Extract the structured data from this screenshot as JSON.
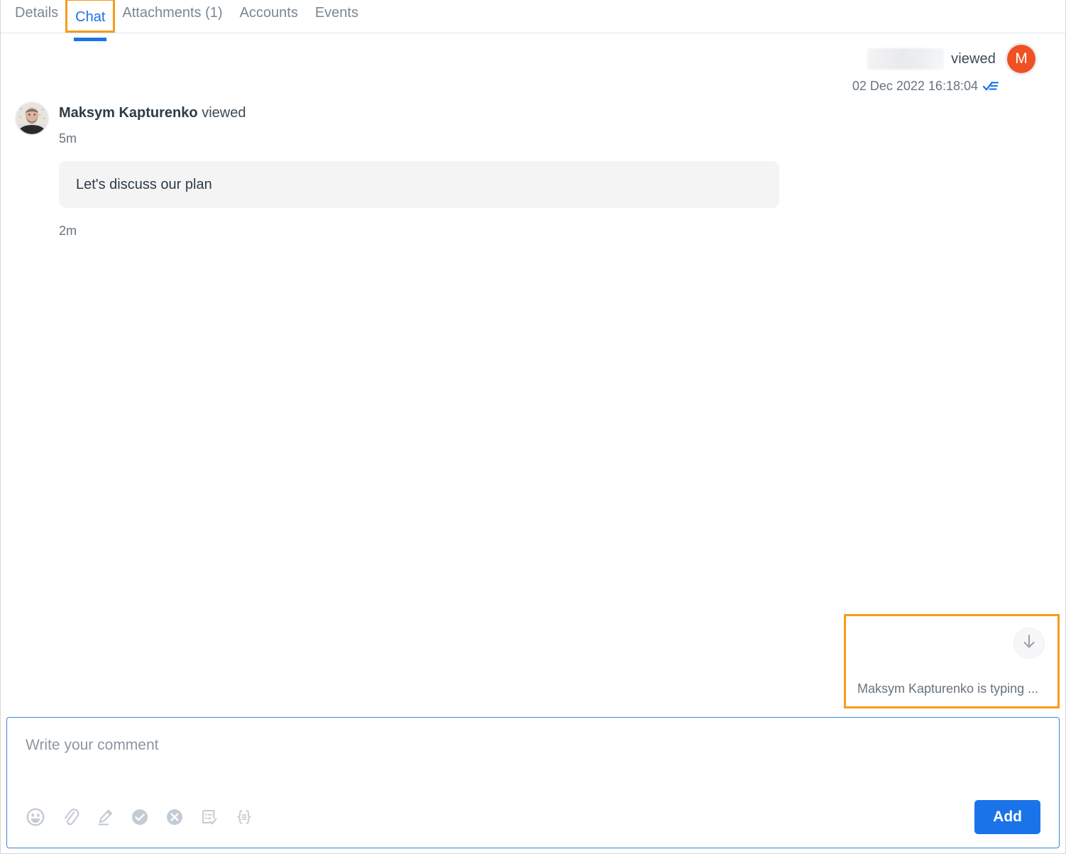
{
  "tabs": [
    {
      "label": "Details",
      "active": false,
      "highlighted": false
    },
    {
      "label": "Chat",
      "active": true,
      "highlighted": true
    },
    {
      "label": "Attachments (1)",
      "active": false,
      "highlighted": false
    },
    {
      "label": "Accounts",
      "active": false,
      "highlighted": false
    },
    {
      "label": "Events",
      "active": false,
      "highlighted": false
    }
  ],
  "colors": {
    "accent_blue": "#1a73e8",
    "highlight_orange": "#f59b1c",
    "avatar_orange": "#f05123",
    "text_muted": "#68737e",
    "bubble_bg": "#f4f4f5"
  },
  "chat": {
    "right_event": {
      "name_redacted": "",
      "action": "viewed",
      "timestamp": "02 Dec 2022 16:18:04",
      "avatar_initial": "M",
      "read_receipt_icon": "double-check-icon"
    },
    "left_message": {
      "author": "Maksym Kapturenko",
      "action": "viewed",
      "time_before": "5m",
      "text": "Let's discuss our plan",
      "time_after": "2m",
      "avatar_icon": "user-photo-avatar"
    },
    "typing_indicator": {
      "text": "Maksym Kapturenko is typing ...",
      "scroll_button_icon": "arrow-down-icon"
    }
  },
  "composer": {
    "placeholder": "Write your comment",
    "value": "",
    "submit_label": "Add",
    "tools": [
      {
        "name": "emoji-icon",
        "title": "Emoji"
      },
      {
        "name": "paperclip-icon",
        "title": "Attach file"
      },
      {
        "name": "pencil-highlight-icon",
        "title": "Draw"
      },
      {
        "name": "check-circle-icon",
        "title": "Approve"
      },
      {
        "name": "x-circle-icon",
        "title": "Reject"
      },
      {
        "name": "checklist-icon",
        "title": "Task"
      },
      {
        "name": "braces-icon",
        "title": "Template"
      }
    ]
  }
}
